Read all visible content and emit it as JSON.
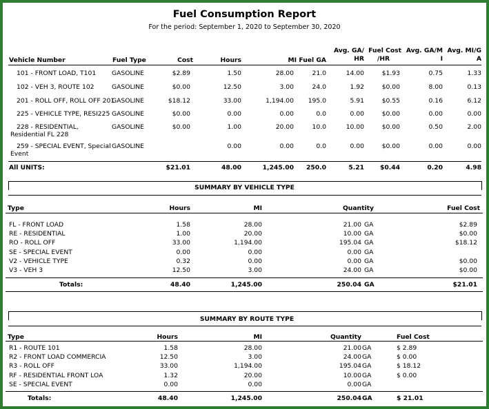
{
  "report": {
    "title": "Fuel Consumption Report",
    "period": "For the period: September  1, 2020 to September 30, 2020"
  },
  "vehicles": {
    "headers": {
      "vehicle": "Vehicle Number",
      "fuel_type": "Fuel Type",
      "cost": "Cost",
      "hours": "Hours",
      "mi": "MI",
      "fuel_ga": "Fuel GA",
      "avg_ga_hr_1": "Avg. GA/",
      "avg_ga_hr_2": "HR",
      "fuel_cost_hr_1": "Fuel Cost",
      "fuel_cost_hr_2": "/HR",
      "avg_ga_mi_1": "Avg. GA/M",
      "avg_ga_mi_2": "I",
      "avg_mi_ga_1": "Avg. MI/G",
      "avg_mi_ga_2": "A"
    },
    "rows": [
      {
        "vehicle": "101 - FRONT LOAD, T101",
        "vehicle2": "",
        "fuel_type": "GASOLINE",
        "cost": "$2.89",
        "hours": "1.50",
        "mi": "28.00",
        "fuel_ga": "21.0",
        "avg_ga_hr": "14.00",
        "fuel_cost_hr": "$1.93",
        "avg_ga_mi": "0.75",
        "avg_mi_ga": "1.33"
      },
      {
        "vehicle": "102 - VEH 3, ROUTE 102",
        "vehicle2": "",
        "fuel_type": "GASOLINE",
        "cost": "$0.00",
        "hours": "12.50",
        "mi": "3.00",
        "fuel_ga": "24.0",
        "avg_ga_hr": "1.92",
        "fuel_cost_hr": "$0.00",
        "avg_ga_mi": "8.00",
        "avg_mi_ga": "0.13"
      },
      {
        "vehicle": "201 - ROLL OFF, ROLL OFF 201",
        "vehicle2": "",
        "fuel_type": "GASOLINE",
        "cost": "$18.12",
        "hours": "33.00",
        "mi": "1,194.00",
        "fuel_ga": "195.0",
        "avg_ga_hr": "5.91",
        "fuel_cost_hr": "$0.55",
        "avg_ga_mi": "0.16",
        "avg_mi_ga": "6.12"
      },
      {
        "vehicle": "225 - VEHICLE TYPE, RESI225",
        "vehicle2": "",
        "fuel_type": "GASOLINE",
        "cost": "$0.00",
        "hours": "0.00",
        "mi": "0.00",
        "fuel_ga": "0.0",
        "avg_ga_hr": "0.00",
        "fuel_cost_hr": "$0.00",
        "avg_ga_mi": "0.00",
        "avg_mi_ga": "0.00"
      },
      {
        "vehicle": "228 - RESIDENTIAL,",
        "vehicle2": "Residential FL 228",
        "fuel_type": "GASOLINE",
        "cost": "$0.00",
        "hours": "1.00",
        "mi": "20.00",
        "fuel_ga": "10.0",
        "avg_ga_hr": "10.00",
        "fuel_cost_hr": "$0.00",
        "avg_ga_mi": "0.50",
        "avg_mi_ga": "2.00"
      },
      {
        "vehicle": "259 - SPECIAL EVENT, Special",
        "vehicle2": "Event",
        "fuel_type": "GASOLINE",
        "cost": "",
        "hours": "0.00",
        "mi": "0.00",
        "fuel_ga": "0.0",
        "avg_ga_hr": "0.00",
        "fuel_cost_hr": "$0.00",
        "avg_ga_mi": "0.00",
        "avg_mi_ga": "0.00"
      }
    ],
    "total": {
      "label": "All UNITS:",
      "cost": "$21.01",
      "hours": "48.00",
      "mi": "1,245.00",
      "fuel_ga": "250.0",
      "avg_ga_hr": "5.21",
      "fuel_cost_hr": "$0.44",
      "avg_ga_mi": "0.20",
      "avg_mi_ga": "4.98"
    }
  },
  "vehicle_type_summary": {
    "title": "SUMMARY BY VEHICLE TYPE",
    "headers": {
      "type": "Type",
      "hours": "Hours",
      "mi": "MI",
      "quantity": "Quantity",
      "fuel_cost": "Fuel Cost"
    },
    "rows": [
      {
        "type": "FL - FRONT LOAD",
        "hours": "1.58",
        "mi": "28.00",
        "quantity": "21.00",
        "unit": "GA",
        "fuel_cost": "$2.89"
      },
      {
        "type": "RE - RESIDENTIAL",
        "hours": "1.00",
        "mi": "20.00",
        "quantity": "10.00",
        "unit": "GA",
        "fuel_cost": "$0.00"
      },
      {
        "type": "RO - ROLL OFF",
        "hours": "33.00",
        "mi": "1,194.00",
        "quantity": "195.04",
        "unit": "GA",
        "fuel_cost": "$18.12"
      },
      {
        "type": "SE - SPECIAL EVENT",
        "hours": "0.00",
        "mi": "0.00",
        "quantity": "0.00",
        "unit": "GA",
        "fuel_cost": ""
      },
      {
        "type": "V2 - VEHICLE TYPE",
        "hours": "0.32",
        "mi": "0.00",
        "quantity": "0.00",
        "unit": "GA",
        "fuel_cost": "$0.00"
      },
      {
        "type": "V3 - VEH 3",
        "hours": "12.50",
        "mi": "3.00",
        "quantity": "24.00",
        "unit": "GA",
        "fuel_cost": "$0.00"
      }
    ],
    "total": {
      "label": "Totals:",
      "hours": "48.40",
      "mi": "1,245.00",
      "quantity": "250.04",
      "unit": "GA",
      "fuel_cost": "$21.01"
    }
  },
  "route_type_summary": {
    "title": "SUMMARY BY ROUTE TYPE",
    "headers": {
      "type": "Type",
      "hours": "Hours",
      "mi": "MI",
      "quantity": "Quantity",
      "fuel_cost": "Fuel Cost"
    },
    "rows": [
      {
        "type": "R1 - ROUTE 101",
        "hours": "1.58",
        "mi": "28.00",
        "quantity": "21.00",
        "unit": "GA",
        "fuel_cost": "$ 2.89"
      },
      {
        "type": "R2 - FRONT LOAD COMMERCIA",
        "hours": "12.50",
        "mi": "3.00",
        "quantity": "24.00",
        "unit": "GA",
        "fuel_cost": "$ 0.00"
      },
      {
        "type": "R3 - ROLL OFF",
        "hours": "33.00",
        "mi": "1,194.00",
        "quantity": "195.04",
        "unit": "GA",
        "fuel_cost": "$ 18.12"
      },
      {
        "type": "RF - RESIDENTIAL FRONT LOA",
        "hours": "1.32",
        "mi": "20.00",
        "quantity": "10.00",
        "unit": "GA",
        "fuel_cost": "$ 0.00"
      },
      {
        "type": "SE - SPECIAL EVENT",
        "hours": "0.00",
        "mi": "0.00",
        "quantity": "0.00",
        "unit": "GA",
        "fuel_cost": ""
      }
    ],
    "total": {
      "label": "Totals:",
      "hours": "48.40",
      "mi": "1,245.00",
      "quantity": "250.04",
      "unit": "GA",
      "fuel_cost": "$ 21.01"
    }
  },
  "colors": {
    "frame": "#2e7d32"
  }
}
